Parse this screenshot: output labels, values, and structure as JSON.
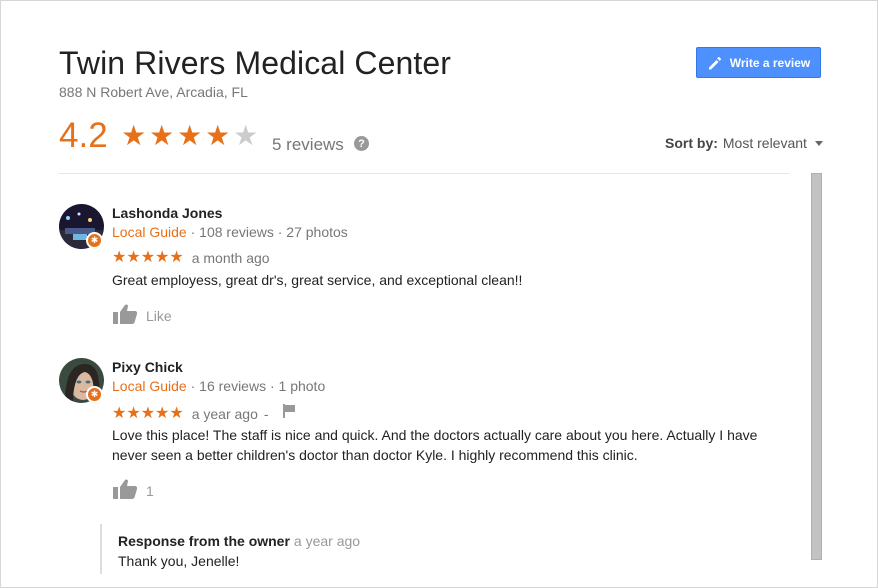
{
  "place": {
    "name": "Twin Rivers Medical Center",
    "address": "888 N Robert Ave, Arcadia, FL"
  },
  "actions": {
    "write_review_label": "Write a review"
  },
  "summary": {
    "rating": "4.2",
    "rating_value": 4.2,
    "review_count_label": "5 reviews",
    "help_icon": "?"
  },
  "sort": {
    "label": "Sort by:",
    "value": "Most relevant"
  },
  "colors": {
    "accent": "#e7711b",
    "button": "#4d90fe"
  },
  "reviews": [
    {
      "author": "Lashonda Jones",
      "badge": "Local Guide",
      "stats": " · 108 reviews · 27 photos",
      "stars": "★★★★★",
      "time": "a month ago",
      "text": "Great employess, great dr's, great service, and exceptional clean!!",
      "like_label": "Like"
    },
    {
      "author": "Pixy Chick",
      "badge": "Local Guide",
      "stats": " · 16 reviews · 1 photo",
      "stars": "★★★★★",
      "time": "a year ago",
      "separator": "-",
      "text": "Love this place! The staff is nice and quick. And the doctors actually care about you here. Actually I have never seen a better children's doctor than doctor Kyle.  I highly recommend this clinic.",
      "like_count": "1",
      "owner_response": {
        "heading": "Response from the owner",
        "time": "a year ago",
        "text": "Thank you, Jenelle!"
      }
    }
  ]
}
